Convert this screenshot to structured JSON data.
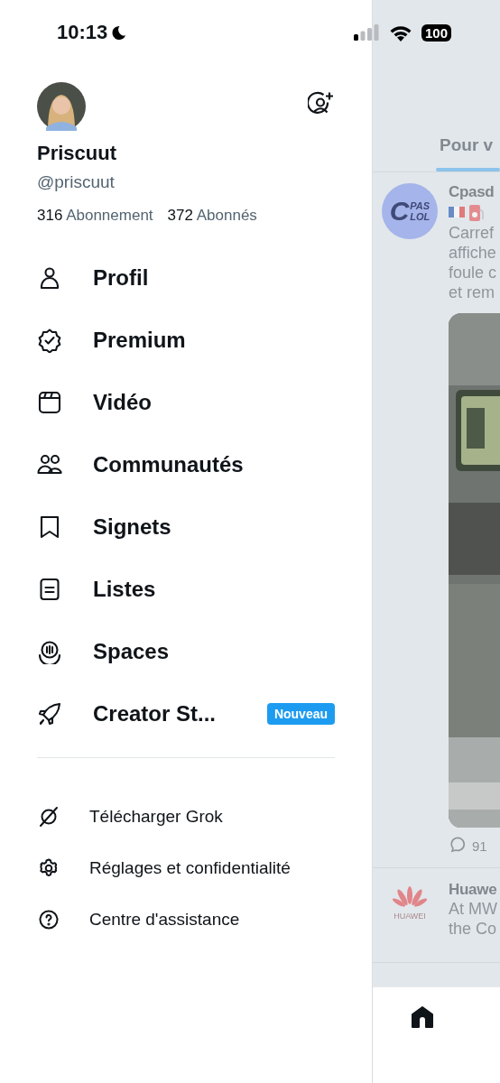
{
  "status_bar": {
    "time": "10:13",
    "battery": "100"
  },
  "profile": {
    "name": "Priscuut",
    "handle": "@priscuut",
    "following_count": "316",
    "following_label": "Abonnement",
    "followers_count": "372",
    "followers_label": "Abonnés"
  },
  "menu": [
    {
      "label": "Profil"
    },
    {
      "label": "Premium"
    },
    {
      "label": "Vidéo"
    },
    {
      "label": "Communautés"
    },
    {
      "label": "Signets"
    },
    {
      "label": "Listes"
    },
    {
      "label": "Spaces"
    },
    {
      "label": "Creator St...",
      "badge": "Nouveau"
    }
  ],
  "secondary_menu": [
    {
      "label": "Télécharger Grok"
    },
    {
      "label": "Réglages et confidentialité"
    },
    {
      "label": "Centre d'assistance"
    }
  ],
  "feed": {
    "tab": "Pour v",
    "posts": [
      {
        "author": "Cpasd",
        "avatar_lines": [
          "C",
          "PAS",
          "LOL"
        ],
        "lines": [
          "Carref",
          "affiche",
          "foule c",
          "et rem"
        ],
        "media": {
          "kind": "picture"
        },
        "reply_count": "91"
      },
      {
        "author": "Huawe",
        "avatar_lines": [
          "HUAWEI"
        ],
        "lines": [
          "At MW",
          "the Co"
        ]
      }
    ]
  }
}
